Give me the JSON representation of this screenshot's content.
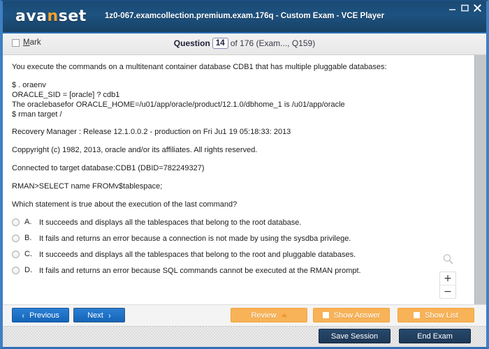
{
  "window": {
    "brand": "avanset",
    "brand_accent_letter": "n",
    "title": "1z0-067.examcollection.premium.exam.176q - Custom Exam - VCE Player",
    "controls": {
      "minimize": "minimize-icon",
      "maximize": "maximize-icon",
      "close": "close-icon"
    },
    "accent_color": "#f5a331",
    "header_color": "#1d5280",
    "border_color": "#3f7fc4"
  },
  "question_bar": {
    "mark_label": "Mark",
    "mark_checked": false,
    "prefix": "Question",
    "number": "14",
    "suffix": "of 176 (Exam..., Q159)"
  },
  "question": {
    "intro": "You execute the commands on a multitenant container database CDB1 that has multiple pluggable databases:",
    "command_block": "$ . oraenv\nORACLE_SID = [oracle] ? cdb1\nThe oraclebasefor ORACLE_HOME=/u01/app/oracle/product/12.1.0/dbhome_1 is /u01/app/oracle\n$ rman target /",
    "line_release": "Recovery Manager : Release 12.1.0.0.2 - production on Fri Ju1 19 05:18:33: 2013",
    "line_copyright": "Coppyright (c) 1982, 2013, oracle and/or its affiliates. All rights reserved.",
    "line_connected": "Connected to target database:CDB1 (DBID=782249327)",
    "line_rman": "RMAN>SELECT name FROMv$tablespace;",
    "prompt": "Which statement is true about the execution of the last command?",
    "options": [
      {
        "letter": "A.",
        "text": "It succeeds and displays all the tablespaces that belong to the root database.",
        "selected": false
      },
      {
        "letter": "B.",
        "text": "It fails and returns an error because a connection is not made by using the sysdba privilege.",
        "selected": false
      },
      {
        "letter": "C.",
        "text": "It succeeds and displays all the tablespaces that belong to the root and pluggable databases.",
        "selected": false
      },
      {
        "letter": "D.",
        "text": "It fails and returns an error because SQL commands cannot be executed at the RMAN prompt.",
        "selected": false
      }
    ]
  },
  "zoom_widget": {
    "magnifier_icon": "magnifier-icon",
    "zoom_in": "+",
    "zoom_out": "−"
  },
  "action_bar": {
    "previous": "Previous",
    "next": "Next",
    "review": "Review",
    "show_answer": "Show Answer",
    "show_list": "Show List",
    "orange_color": "#f8b257",
    "blue_color": "#1565b8"
  },
  "status_bar": {
    "save_session": "Save Session",
    "end_exam": "End Exam"
  }
}
